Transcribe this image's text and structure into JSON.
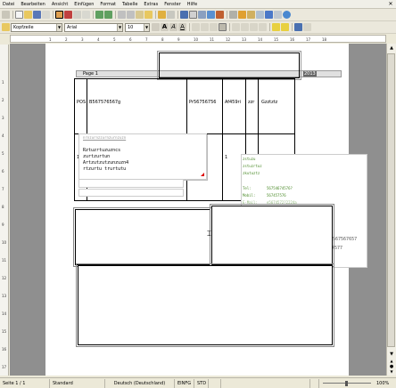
{
  "menu": [
    "Datei",
    "Bearbeiten",
    "Ansicht",
    "Einfügen",
    "Format",
    "Tabelle",
    "Extras",
    "Fenster",
    "Hilfe"
  ],
  "toolbar2": {
    "paragraph_style": "Kopfzeile",
    "font_name": "Arial",
    "font_size": "10"
  },
  "ruler_h": [
    "1",
    "2",
    "3",
    "4",
    "5",
    "6",
    "7",
    "8",
    "9",
    "10",
    "11",
    "12",
    "13",
    "14",
    "15",
    "16",
    "17",
    "18"
  ],
  "ruler_v": [
    "1",
    "2",
    "3",
    "4",
    "5",
    "6",
    "7",
    "8",
    "9",
    "10",
    "11",
    "12",
    "13",
    "14",
    "15",
    "16",
    "17"
  ],
  "document": {
    "header_page_label": "Page 1",
    "header_year": "2013",
    "table_row": {
      "pos": "POS",
      "article": "B567576567g",
      "number": "Pr56756756",
      "code": "Af459ri",
      "unit": "zzr",
      "desc": "Gzztztz"
    },
    "row_num": "1",
    "popup_title": "nrnzurnzzurnzurnzuzn",
    "popup_lines": [
      "Rztuzrtuzuzncs",
      "zurtzurtun",
      "Artzutzutzunzuzn4",
      "rtzurtu trurtutu"
    ],
    "contact_green": [
      "zstuzu",
      "zstuzrtuz",
      "zkutuztz"
    ],
    "contact_tel_label": "Tel:",
    "contact_tel": "56754674576?",
    "contact_mobil_label": "Mobil:",
    "contact_mobil": "567457576",
    "contact_email_label": "E-Mail:",
    "contact_email": "e5674572?2224a",
    "side_number_1": "2567567657",
    "side_number_2": "4577"
  },
  "status": {
    "page": "Seite 1 / 1",
    "style": "Standard",
    "language": "Deutsch (Deutschland)",
    "insert_mode": "EINFG",
    "selection_mode": "STD",
    "zoom": "100%"
  },
  "colors": {
    "toolbar_bg": "#ebe8dc",
    "workspace": "#8f8f8f",
    "green_text": "#4a8a28",
    "header_row": "#e0e0e0"
  }
}
